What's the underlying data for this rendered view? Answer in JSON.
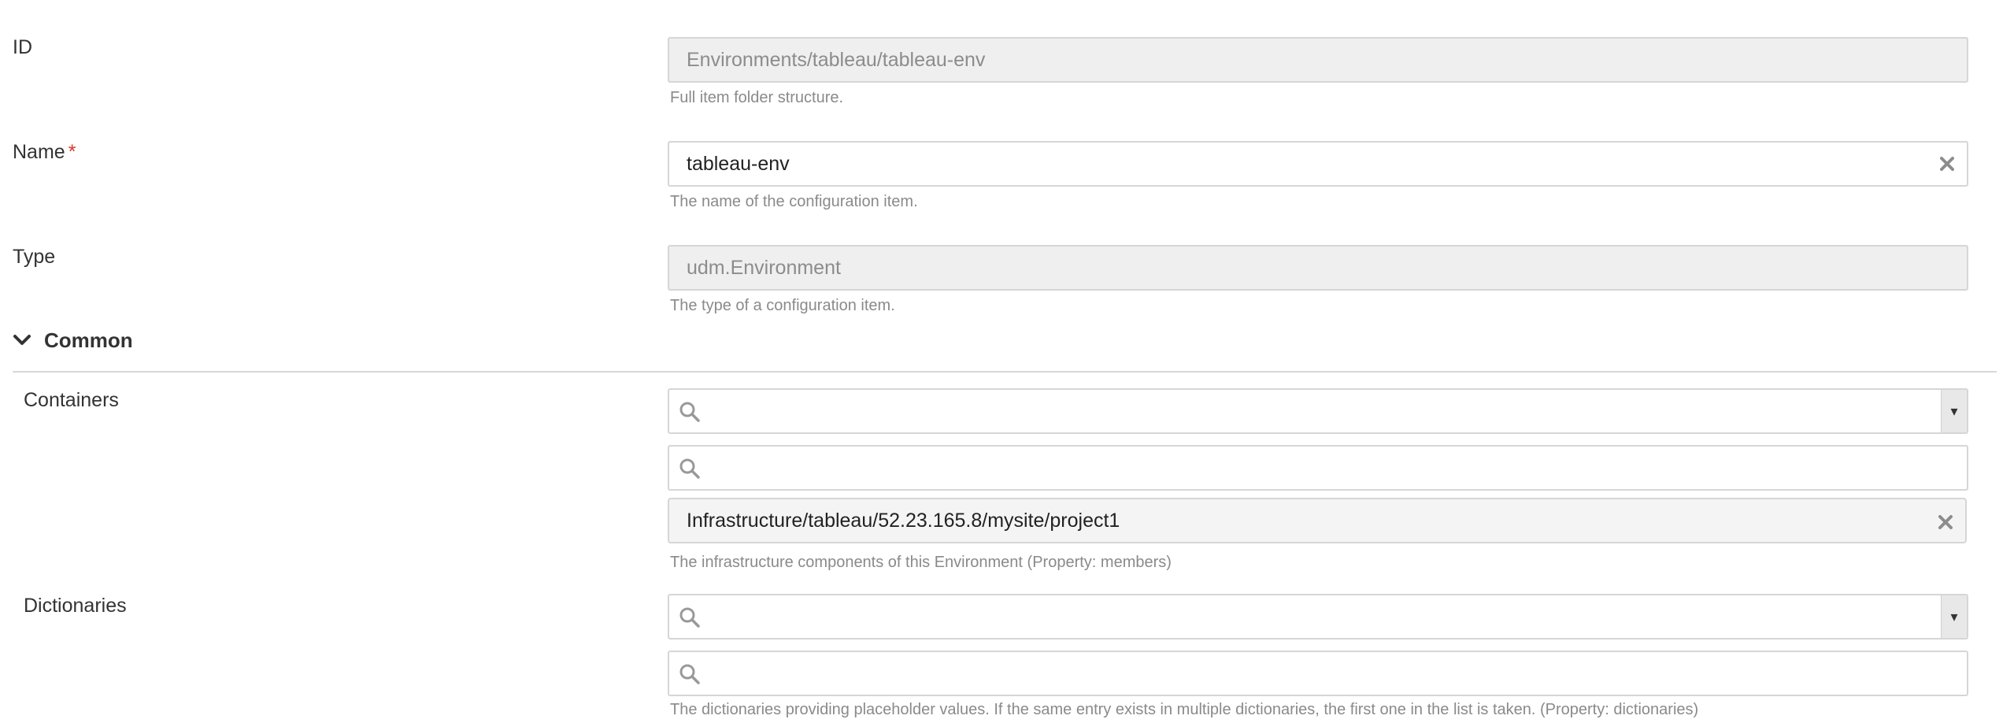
{
  "id_field": {
    "label": "ID",
    "value": "Environments/tableau/tableau-env",
    "help": "Full item folder structure."
  },
  "name_field": {
    "label": "Name",
    "required_mark": "*",
    "value": "tableau-env",
    "help": "The name of the configuration item.",
    "clear_icon": "close-icon"
  },
  "type_field": {
    "label": "Type",
    "value": "udm.Environment",
    "help": "The type of a configuration item."
  },
  "common_section": {
    "title": "Common",
    "expanded": true,
    "toggle_icon": "chevron-down-icon"
  },
  "containers": {
    "label": "Containers",
    "selector_caret": "▾",
    "filter_placeholder": "",
    "items": [
      "Infrastructure/tableau/52.23.165.8/mysite/project1"
    ],
    "help": "The infrastructure components of this Environment (Property: members)"
  },
  "dictionaries": {
    "label": "Dictionaries",
    "selector_caret": "▾",
    "filter_placeholder": "",
    "help": "The dictionaries providing placeholder values. If the same entry exists in multiple dictionaries, the first one in the list is taken. (Property: dictionaries)"
  },
  "colors": {
    "required": "#d9352b",
    "readonly_bg": "#efefef",
    "border": "#d6d6d6",
    "help_text": "#8a8a8a"
  }
}
